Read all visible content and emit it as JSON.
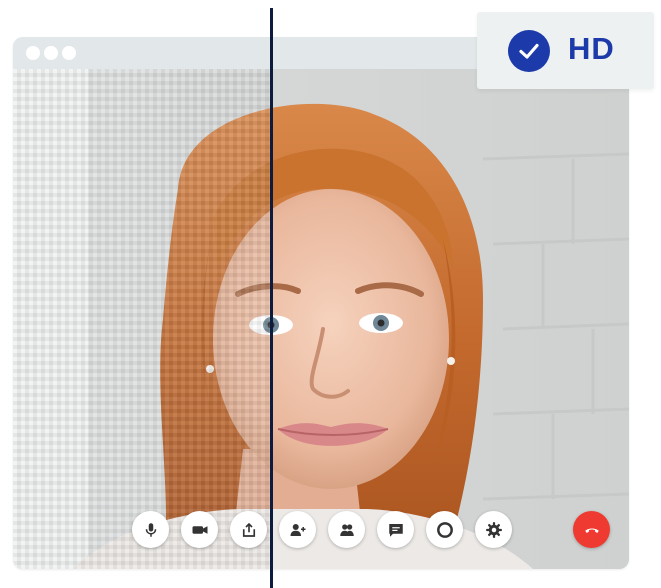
{
  "badge": {
    "label": "HD",
    "icon": "checkmark-icon",
    "color": "#1c3aa9"
  },
  "window": {
    "title_dots": [
      "dot",
      "dot",
      "dot"
    ]
  },
  "video": {
    "subject": "video-feed-person",
    "comparison": "pixelated-vs-hd"
  },
  "controls": [
    {
      "name": "microphone-button",
      "icon": "microphone-icon"
    },
    {
      "name": "camera-button",
      "icon": "video-camera-icon"
    },
    {
      "name": "share-screen-button",
      "icon": "share-icon"
    },
    {
      "name": "add-participant-button",
      "icon": "add-person-icon"
    },
    {
      "name": "participants-button",
      "icon": "people-icon"
    },
    {
      "name": "chat-button",
      "icon": "chat-icon"
    },
    {
      "name": "record-button",
      "icon": "record-icon"
    },
    {
      "name": "settings-button",
      "icon": "gear-icon"
    },
    {
      "name": "end-call-button",
      "icon": "hang-up-icon",
      "color": "#ee3a30"
    }
  ]
}
